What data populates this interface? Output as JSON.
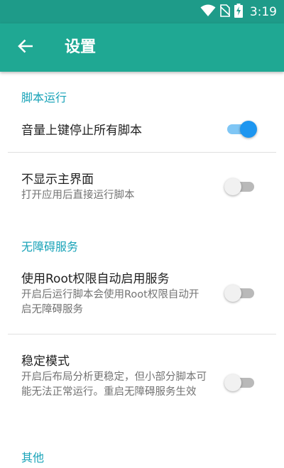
{
  "status_bar": {
    "time": "3:19",
    "icons": [
      "wifi-icon",
      "no-sim-icon",
      "battery-charging-icon"
    ]
  },
  "app_bar": {
    "back_icon": "arrow-back-icon",
    "title": "设置"
  },
  "colors": {
    "status_bar": "#1e9b89",
    "app_bar": "#1fa893",
    "section_header": "#19a3b8",
    "switch_on_thumb": "#1e96f0",
    "switch_on_track": "#7fc6f5",
    "switch_off_thumb": "#f1f1f1",
    "switch_off_track": "#b9b9b9"
  },
  "sections": [
    {
      "header": "脚本运行",
      "items": [
        {
          "title": "音量上键停止所有脚本",
          "summary": "",
          "checked": true
        },
        {
          "title": "不显示主界面",
          "summary": "打开应用后直接运行脚本",
          "checked": false
        }
      ]
    },
    {
      "header": "无障碍服务",
      "items": [
        {
          "title": "使用Root权限自动启用服务",
          "summary": "开启后运行脚本会使用Root权限自动开启无障碍服务",
          "checked": false
        },
        {
          "title": "稳定模式",
          "summary": "开启后布局分析更稳定，但小部分脚本可能无法正常运行。重启无障碍服务生效",
          "checked": false
        }
      ]
    },
    {
      "header": "其他",
      "items": []
    }
  ]
}
